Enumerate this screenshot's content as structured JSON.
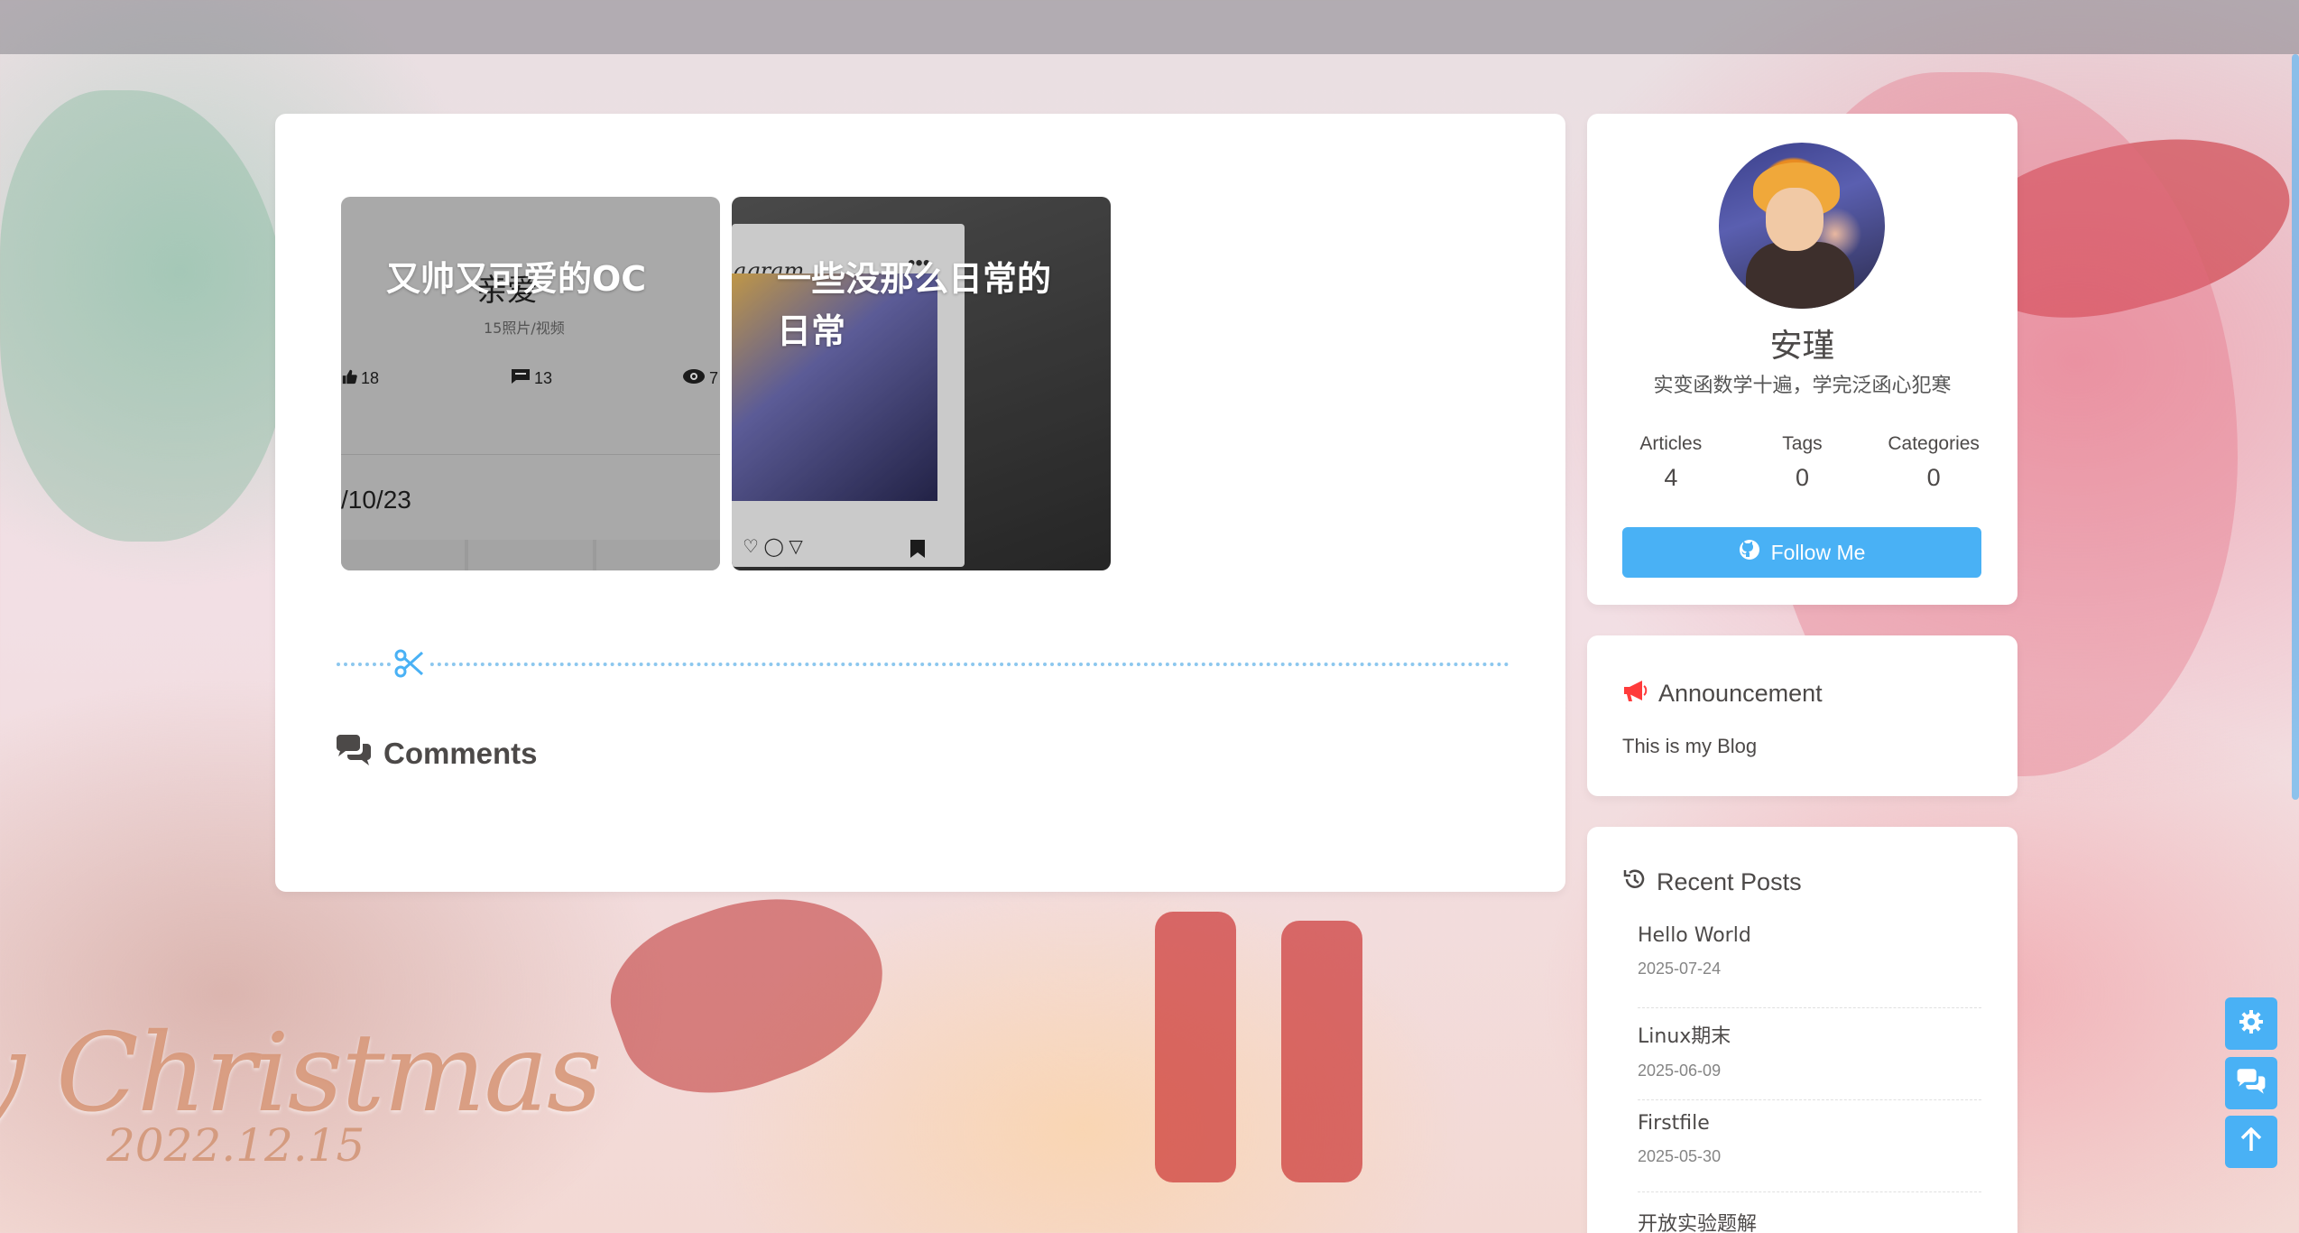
{
  "albums": [
    {
      "title": "又帅又可爱的OC",
      "preview": {
        "subtitle": "亲爱",
        "count": "15照片/视频",
        "likes": "18",
        "comments": "13",
        "views": "7",
        "date": "/10/23"
      }
    },
    {
      "title": "一些没那么日常的日常",
      "preview": {
        "app_name": "agram"
      }
    }
  ],
  "comments": {
    "heading": "Comments"
  },
  "profile": {
    "name": "安瑾",
    "description": "实变函数学十遍，学完泛函心犯寒",
    "stats": [
      {
        "label": "Articles",
        "value": "4"
      },
      {
        "label": "Tags",
        "value": "0"
      },
      {
        "label": "Categories",
        "value": "0"
      }
    ],
    "follow_label": "Follow Me"
  },
  "announcement": {
    "heading": "Announcement",
    "text": "This is my Blog"
  },
  "recent_posts": {
    "heading": "Recent Posts",
    "items": [
      {
        "title": "Hello World",
        "date": "2025-07-24"
      },
      {
        "title": "Linux期末",
        "date": "2025-06-09"
      },
      {
        "title": "Firstfile",
        "date": "2025-05-30"
      },
      {
        "title": "开放实验题解",
        "date": ""
      }
    ]
  },
  "background": {
    "banner_text": "y Christmas",
    "banner_date": "2022.12.15"
  },
  "colors": {
    "accent": "#49b1f5",
    "card": "#ffffff",
    "text": "#4c4948"
  },
  "icons": {
    "settings": "gear-icon",
    "chat": "comments-icon",
    "top": "arrow-up-icon"
  }
}
